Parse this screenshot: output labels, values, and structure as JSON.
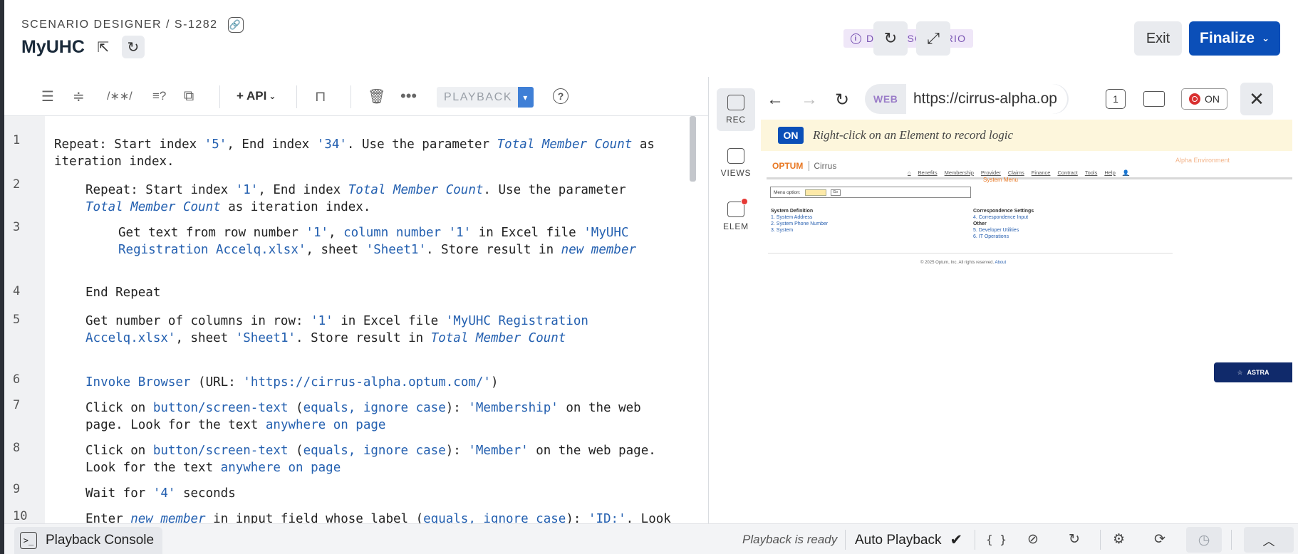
{
  "header": {
    "breadcrumb": "SCENARIO DESIGNER / S-1282",
    "title": "MyUHC",
    "draft_badge": "DRAFT SCENARIO",
    "exit_label": "Exit",
    "finalize_label": "Finalize"
  },
  "toolbar": {
    "api_label": "+ API",
    "playback_label": "PLAYBACK"
  },
  "steps": [
    {
      "num": "1"
    },
    {
      "num": "2"
    },
    {
      "num": "3"
    },
    {
      "num": "4"
    },
    {
      "num": "5"
    },
    {
      "num": "6"
    },
    {
      "num": "7"
    },
    {
      "num": "8"
    },
    {
      "num": "9"
    },
    {
      "num": "10"
    }
  ],
  "step_text": {
    "s1_a": "Repeat: Start index ",
    "s1_b": "'5'",
    "s1_c": ", End index ",
    "s1_d": "'34'",
    "s1_e": ". Use the parameter ",
    "s1_f": "Total Member Count",
    "s1_g": " as iteration index.",
    "s2_a": "Repeat: Start index ",
    "s2_b": "'1'",
    "s2_c": ", End index ",
    "s2_d": "Total Member Count",
    "s2_e": ". Use the parameter ",
    "s2_f": "Total Member Count",
    "s2_g": " as iteration index.",
    "s3_a": "Get text from row number ",
    "s3_b": "'1'",
    "s3_c": ", ",
    "s3_d": "column number '1'",
    "s3_e": " in Excel file ",
    "s3_f": "'MyUHC Registration Accelq.xlsx'",
    "s3_g": ", sheet ",
    "s3_h": "'Sheet1'",
    "s3_i": ". Store result in ",
    "s3_j": "new member",
    "s4_a": "End Repeat",
    "s5_a": "Get number of columns in row: ",
    "s5_b": "'1'",
    "s5_c": " in Excel file ",
    "s5_d": "'MyUHC Registration Accelq.xlsx'",
    "s5_e": ", sheet ",
    "s5_f": "'Sheet1'",
    "s5_g": ". Store result in ",
    "s5_h": "Total Member Count",
    "s6_a": "Invoke Browser",
    "s6_b": " (URL: ",
    "s6_c": "'https://cirrus-alpha.optum.com/'",
    "s6_d": ")",
    "s7_a": "Click on ",
    "s7_b": "button/screen-text",
    "s7_c": " (",
    "s7_d": "equals, ignore case",
    "s7_e": "): ",
    "s7_f": "'Membership'",
    "s7_g": " on the web page. Look for the text ",
    "s7_h": "anywhere on page",
    "s8_a": "Click on ",
    "s8_b": "button/screen-text",
    "s8_c": " (",
    "s8_d": "equals, ignore case",
    "s8_e": "): ",
    "s8_f": "'Member'",
    "s8_g": " on the web page. Look for the text ",
    "s8_h": "anywhere on page",
    "s9_a": "Wait for ",
    "s9_b": "'4'",
    "s9_c": " seconds",
    "s10_a": "Enter ",
    "s10_b": "new member",
    "s10_c": " in input field whose label (",
    "s10_d": "equals, ignore case",
    "s10_e": "): ",
    "s10_f": "'ID:'",
    "s10_g": ". Look"
  },
  "rail": {
    "rec": "REC",
    "views": "VIEWS",
    "elem": "ELEM"
  },
  "browser": {
    "mode": "WEB",
    "url": "https://cirrus-alpha.op",
    "tab_count": "1",
    "rec_state": "ON",
    "notice_badge": "ON",
    "notice_text": "Right-click on an Element to record logic"
  },
  "webview": {
    "brand": "OPTUM",
    "product": "Cirrus",
    "environment": "Alpha Environment",
    "menu": [
      "Benefits",
      "Membership",
      "Provider",
      "Claims",
      "Finance",
      "Contract",
      "Tools",
      "Help"
    ],
    "system_menu": "System Menu",
    "menu_option_label": "Menu option:",
    "go_label": "Go",
    "left_heading": "System Definition",
    "left_items": [
      "1. System Address",
      "2. System Phone Number",
      "3. System"
    ],
    "right_heading": "Correspondence Settings",
    "right_items": [
      "4. Correspondence Input"
    ],
    "other_heading": "Other",
    "other_items": [
      "5. Developer Utilities",
      "6. IT Operations"
    ],
    "footer": "© 2025 Optum, Inc. All rights reserved.",
    "footer_link": "About",
    "astra_label": "ASTRA"
  },
  "statusbar": {
    "console_label": "Playback Console",
    "status_text": "Playback is ready",
    "auto_playback": "Auto Playback",
    "braces": "{ }"
  }
}
